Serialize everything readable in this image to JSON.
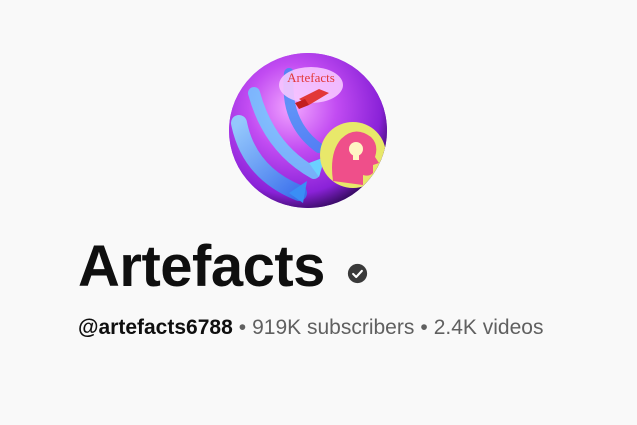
{
  "avatar": {
    "logo_text": "Artefacts",
    "icon": "lightbulb-head-icon"
  },
  "channel": {
    "name": "Artefacts",
    "verified_icon": "verified-check-icon",
    "handle": "@artefacts6788",
    "separator": "•",
    "subscribers": "919K subscribers",
    "videos": "2.4K videos"
  },
  "colors": {
    "background": "#f9f9f9",
    "primary_text": "#0f0f0f",
    "secondary_text": "#606060"
  }
}
